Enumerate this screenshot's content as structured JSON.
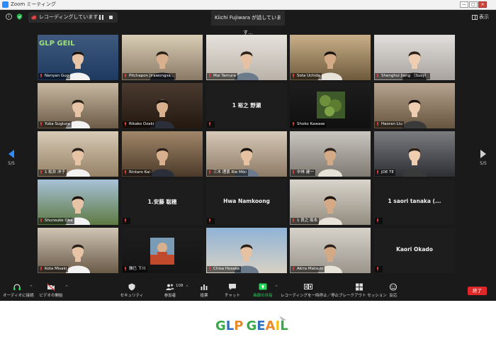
{
  "window": {
    "title": "Zoom ミーティング",
    "controls": [
      "—",
      "□",
      "×"
    ]
  },
  "topbar": {
    "recording_status": "レコーディングしています...",
    "speaking": "Kiichi Fujiwara が話しています...",
    "view_label": "表示"
  },
  "pagination": {
    "left_page": "5/5",
    "right_page": "5/5"
  },
  "participants": [
    {
      "name": "Nanyan Guo",
      "video": true,
      "banner": "GLP GEIL"
    },
    {
      "name": "Pitchapon Jirawongsa...",
      "video": true
    },
    {
      "name": "Mai Tamura",
      "video": true
    },
    {
      "name": "Sota Uchida",
      "video": true
    },
    {
      "name": "Shenghui Jiang （Susy）",
      "video": true
    },
    {
      "name": "Yuka Sugiura",
      "video": true
    },
    {
      "name": "Rikako Ozaki",
      "video": true
    },
    {
      "name": "1 裕之 野瀬",
      "video": false
    },
    {
      "name": "Shoko Kawase",
      "video": true
    },
    {
      "name": "Haoran Liu",
      "video": true
    },
    {
      "name": "1 松井 洋子",
      "video": true
    },
    {
      "name": "Rintaro Kai",
      "video": true
    },
    {
      "name": "三木 理恵 Rie Miki",
      "video": true
    },
    {
      "name": "中林 建一",
      "video": true
    },
    {
      "name": "JOE TE",
      "video": true
    },
    {
      "name": "Shunsuke Oba",
      "video": true
    },
    {
      "name": "1.安藤 聡穂",
      "video": false
    },
    {
      "name": "Hwa Namkoong",
      "video": false
    },
    {
      "name": "1 良之 坂本",
      "video": true
    },
    {
      "name": "1 saori tanaka (...",
      "video": false
    },
    {
      "name": "Kota Misaki",
      "video": true
    },
    {
      "name": "雅巳 下川",
      "video": true
    },
    {
      "name": "Chisa Hosaka",
      "video": true
    },
    {
      "name": "Akira Matsuki",
      "video": true
    },
    {
      "name": "Kaori Okado",
      "video": false
    }
  ],
  "toolbar": {
    "audio": "オーディオに接続",
    "video": "ビデオの開始",
    "security": "セキュリティ",
    "participants": "参加者",
    "participant_count": "108",
    "poll": "投票",
    "chat": "チャット",
    "share": "画面の共有",
    "record": "レコーディングを一時停止／停止",
    "breakout": "ブレークアウト セッション",
    "reactions": "反応",
    "end": "終了"
  },
  "logo": {
    "text": "GLP GEIL"
  },
  "colors": {
    "accent": "#2d8cff",
    "share_green": "#23d959",
    "end_red": "#e02828",
    "logo_green": "#3aa84a",
    "logo_blue": "#2f6fbf",
    "logo_orange": "#e8892a",
    "logo_yellow": "#f1c21b",
    "muted_mic": "#e34040"
  }
}
